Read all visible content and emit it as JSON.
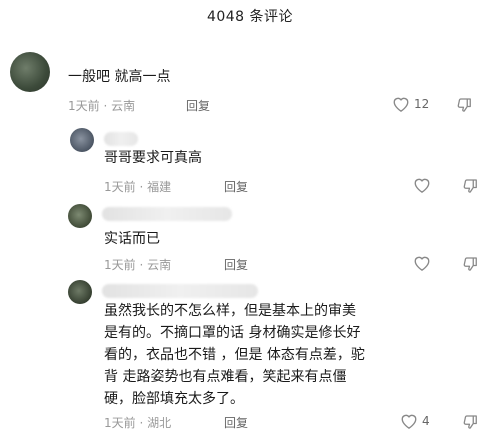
{
  "header": {
    "title": "4048 条评论"
  },
  "comments": [
    {
      "text": "一般吧 就高一点",
      "time": "1天前",
      "location": "云南",
      "reply_label": "回复",
      "likes": "12"
    },
    {
      "text": "哥哥要求可真高",
      "time": "1天前",
      "location": "福建",
      "reply_label": "回复",
      "likes": ""
    },
    {
      "text": "实话而已",
      "time": "1天前",
      "location": "云南",
      "reply_label": "回复",
      "likes": ""
    },
    {
      "text_lines": [
        "虽然我长的不怎么样，但是基本上的审美",
        "是有的。不摘口罩的话 身材确实是修长好",
        "看的，衣品也不错 ，但是 体态有点差，驼",
        "背 走路姿势也有点难看，笑起来有点僵",
        "硬，脸部填充太多了。"
      ],
      "time": "1天前",
      "location": "湖北",
      "reply_label": "回复",
      "likes": "4"
    }
  ],
  "separator": " · ",
  "icons": {
    "like": "heart-outline-icon",
    "dislike": "thumbs-down-icon"
  },
  "colors": {
    "meta": "#999999",
    "text": "#1a1a1a"
  }
}
